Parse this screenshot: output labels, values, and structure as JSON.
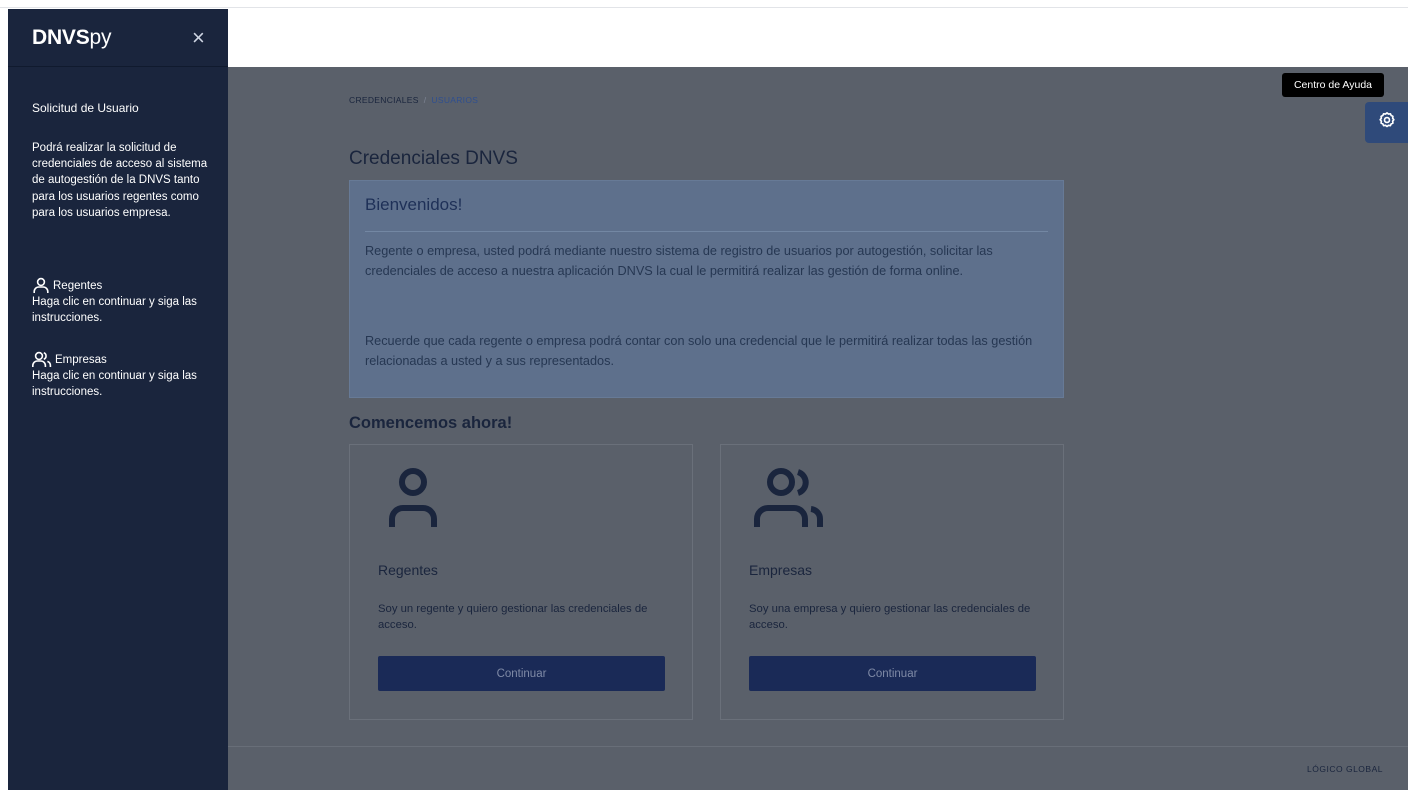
{
  "sidebar": {
    "brand_bold": "DNVS",
    "brand_light": "py",
    "close_label": "×",
    "section_title": "Solicitud de Usuario",
    "intro": "Podrá realizar la solicitud de credenciales de acceso al sistema de autogestión de la DNVS tanto para los usuarios regentes como para los usuarios empresa.",
    "items": [
      {
        "icon": "user-icon",
        "label": "Regentes",
        "text": "Haga clic en continuar y siga las instrucciones."
      },
      {
        "icon": "users-icon",
        "label": "Empresas",
        "text": "Haga clic en continuar y siga las instrucciones."
      }
    ]
  },
  "breadcrumb": {
    "items": [
      "CREDENCIALES",
      "USUARIOS"
    ],
    "separator": "/"
  },
  "page_title": "Credenciales DNVS",
  "welcome": {
    "title": "Bienvenidos!",
    "paragraph1": "Regente o empresa, usted podrá mediante nuestro sistema de registro de usuarios por autogestión, solicitar las credenciales de acceso a nuestra aplicación DNVS la cual le permitirá realizar las gestión de forma online.",
    "paragraph2": "Recuerde que cada regente o empresa podrá contar con solo una credencial que le permitirá realizar todas las gestión relacionadas a usted y a sus representados."
  },
  "start_title": "Comencemos ahora!",
  "cards": [
    {
      "icon": "user-icon",
      "title": "Regentes",
      "description": "Soy un regente y quiero gestionar las credenciales de acceso.",
      "button": "Continuar"
    },
    {
      "icon": "users-icon",
      "title": "Empresas",
      "description": "Soy una empresa y quiero gestionar las credenciales de acceso.",
      "button": "Continuar"
    }
  ],
  "footer": {
    "brand": "LÓGICO GLOBAL"
  },
  "help": {
    "tooltip": "Centro de Ayuda",
    "icon": "gear-icon"
  },
  "colors": {
    "sidebar_bg": "#1a253d",
    "overlay_bg": "#5a606a",
    "button_bg": "#1a2a57",
    "help_button_bg": "#2f4a7a",
    "accent_link": "#2f4f8f"
  }
}
